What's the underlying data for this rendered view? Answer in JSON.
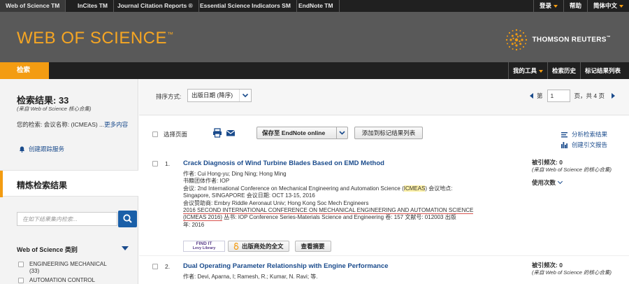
{
  "topnav": {
    "products": [
      "Web of Science TM",
      "InCites TM",
      "Journal Citation Reports ®",
      "Essential Science Indicators SM",
      "EndNote TM"
    ],
    "login": "登录",
    "help": "帮助",
    "language": "简体中文"
  },
  "header": {
    "logo": "WEB OF SCIENCE",
    "logo_tm": "™",
    "brand": "THOMSON REUTERS",
    "brand_tm": "™"
  },
  "subnav": {
    "search_tab": "检索",
    "my_tools": "我的工具",
    "history": "检索历史",
    "marked_list": "标记结果列表"
  },
  "left": {
    "results_title": "检索结果: 33",
    "results_source": "(来自 Web of Science 核心合集)",
    "query_prefix": "您的检索: 会议名称: (ICMEAS) ...",
    "query_more": "更多内容",
    "alert": "创建跟踪服务",
    "refine_title": "精炼检索结果",
    "search_placeholder": "在如下结果集内检索...",
    "category_title": "Web of Science 类别",
    "categories": [
      {
        "label": "ENGINEERING MECHANICAL",
        "count": "(33)"
      },
      {
        "label": "AUTOMATION CONTROL",
        "count": ""
      }
    ]
  },
  "sortbar": {
    "label": "排序方式:",
    "selected": "出版日期 (降序)",
    "page_prefix": "第",
    "page_value": "1",
    "page_suffix": "页，共 4 页"
  },
  "toolbar": {
    "select_page": "选择页面",
    "endnote": "保存至 EndNote online",
    "add_marked": "添加到标记结果列表",
    "analyze": "分析检索结果",
    "citation_report": "创建引文报告"
  },
  "records": [
    {
      "num": "1.",
      "title": "Crack Diagnosis of Wind Turbine Blades Based on EMD Method",
      "authors": "作者: Cui Hong-yu; Ding Ning; Hong Ming",
      "group_author": "书籍团体作者: IOP",
      "conf_pre": "会议: 2nd International Conference on Mechanical Engineering and Automation Science (",
      "conf_hl": "ICMEAS",
      "conf_post": ") 会议地点:",
      "conf_loc": "Singapore, SINGAPORE 会议日期: OCT 13-15, 2016",
      "sponsor": "会议赞助商: Embry Riddle Aeronaut Univ; Hong Kong Soc Mech Engineers",
      "series_line1": "2016 SECOND INTERNATIONAL CONFERENCE ON MECHANICAL ENGINEERING AND AUTOMATION SCIENCE",
      "series_line2_ul": "(ICMEAS 2016)",
      "series_line2_rest": " 丛书: IOP Conference Series-Materials Science and Engineering   卷: 157   文献号: 012003   出版",
      "year": "年: 2016",
      "cited": "被引频次: 0",
      "cited_src": "(来自 Web of Science 的核心合集)",
      "usage": "使用次数",
      "findit_line1": "FIND IT",
      "findit_line2": "Levy Library",
      "full_text": "出版商处的全文",
      "abstract": "查看摘要"
    },
    {
      "num": "2.",
      "title": "Dual Operating Parameter Relationship with Engine Performance",
      "authors": "作者: Devi, Aparna, I; Ramesh, R.; Kumar, N. Ravi; 等.",
      "cited": "被引频次: 0",
      "cited_src": "(来自 Web of Science 的核心合集)"
    }
  ],
  "colors": {
    "accent": "#f39c12",
    "header_bg": "#595959",
    "nav_bg": "#202020",
    "link": "#1a4b8c"
  }
}
